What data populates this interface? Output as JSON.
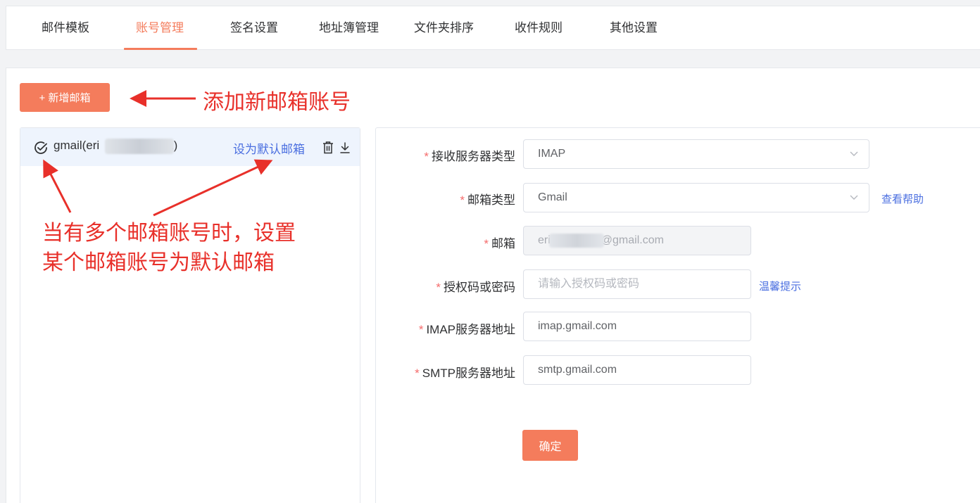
{
  "tabs": [
    {
      "label": "邮件模板"
    },
    {
      "label": "账号管理",
      "active": true
    },
    {
      "label": "签名设置"
    },
    {
      "label": "地址簿管理"
    },
    {
      "label": "文件夹排序"
    },
    {
      "label": "收件规则"
    },
    {
      "label": "其他设置"
    }
  ],
  "toolbar": {
    "add_mailbox_label": "+ 新增邮箱"
  },
  "accounts": [
    {
      "name_prefix": "gmail(eri",
      "name_suffix": "1)",
      "set_default_label": "设为默认邮箱"
    }
  ],
  "form": {
    "required_mark": "*",
    "receive_server_type": {
      "label": "接收服务器类型",
      "value": "IMAP"
    },
    "mailbox_type": {
      "label": "邮箱类型",
      "value": "Gmail",
      "help_link": "查看帮助"
    },
    "email": {
      "label": "邮箱",
      "value_prefix": "eri",
      "value_suffix": "@gmail.com"
    },
    "auth_code": {
      "label": "授权码或密码",
      "placeholder": "请输入授权码或密码",
      "hint_link": "温馨提示"
    },
    "imap_server": {
      "label": "IMAP服务器地址",
      "value": "imap.gmail.com"
    },
    "smtp_server": {
      "label": "SMTP服务器地址",
      "value": "smtp.gmail.com"
    },
    "submit_label": "确定"
  },
  "annotations": {
    "add_account": "添加新邮箱账号",
    "default_line1": "当有多个邮箱账号时，设置",
    "default_line2": "某个邮箱账号为默认邮箱"
  },
  "colors": {
    "accent": "#f47c5c",
    "link": "#4b6fe0",
    "annotation": "#e8302a",
    "required": "#f56c6c"
  },
  "icons": [
    "check-circle-icon",
    "trash-icon",
    "download-icon",
    "chevron-down-icon"
  ]
}
